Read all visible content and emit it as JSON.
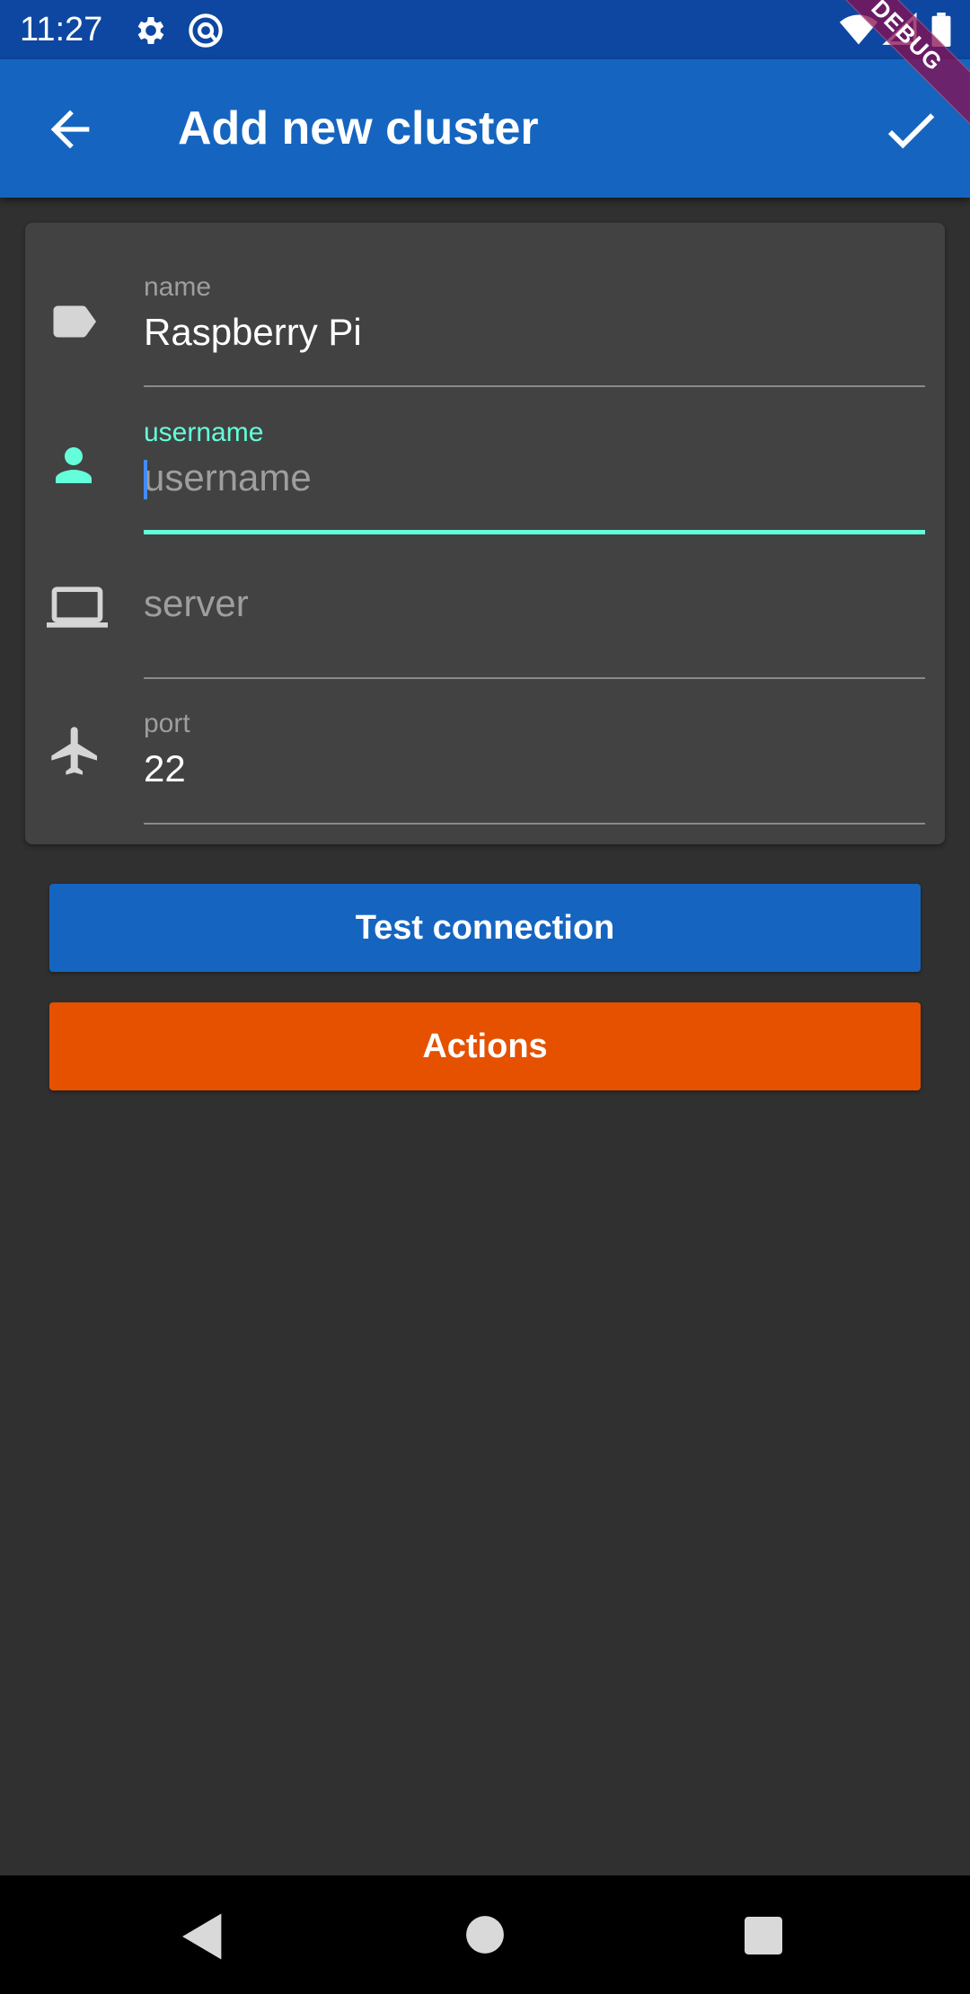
{
  "status_bar": {
    "time": "11:27",
    "icons": [
      "gear-icon",
      "at-icon",
      "wifi-icon",
      "signal-icon",
      "battery-icon"
    ]
  },
  "app_bar": {
    "title": "Add new cluster",
    "back_icon": "arrow-back-icon",
    "confirm_icon": "check-icon",
    "color": "#1565c0"
  },
  "debug_banner": "DEBUG",
  "form": {
    "name": {
      "label": "name",
      "value": "Raspberry Pi",
      "icon": "label-icon"
    },
    "username": {
      "label": "username",
      "value": "",
      "placeholder": "username",
      "icon": "person-icon",
      "focused": true
    },
    "server": {
      "label": "",
      "value": "",
      "placeholder": "server",
      "icon": "laptop-icon"
    },
    "port": {
      "label": "port",
      "value": "22",
      "icon": "airplane-icon"
    }
  },
  "buttons": {
    "test_connection": "Test connection",
    "actions": "Actions"
  },
  "colors": {
    "accent": "#64ffda",
    "primary": "#1565c0",
    "actions": "#e65100",
    "background": "#303030",
    "card": "#424242"
  },
  "nav_bar": {
    "icons": [
      "nav-back-icon",
      "nav-home-icon",
      "nav-recents-icon"
    ]
  }
}
